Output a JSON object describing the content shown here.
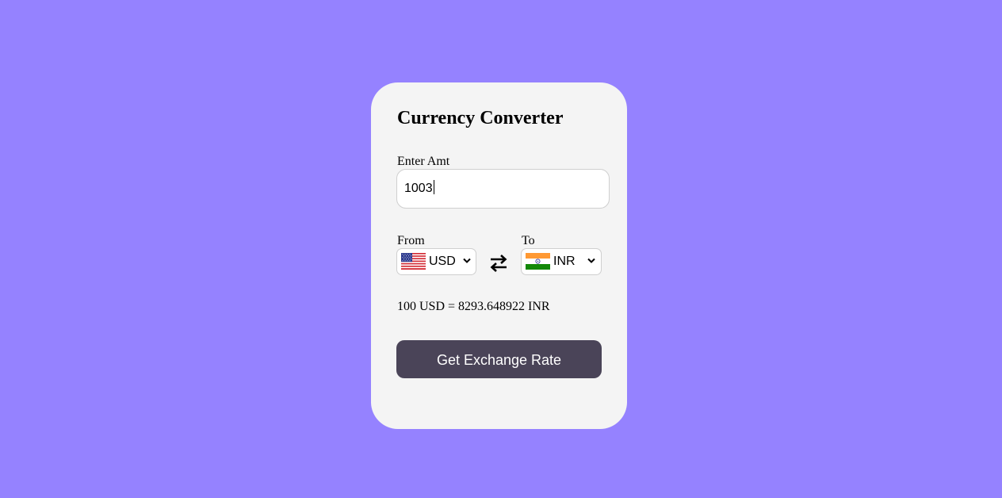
{
  "converter": {
    "title": "Currency Converter",
    "amount_label": "Enter Amt",
    "amount_value": "1003",
    "from_label": "From",
    "from_currency": "USD",
    "from_flag_icon": "us-flag-icon",
    "to_label": "To",
    "to_currency": "INR",
    "to_flag_icon": "india-flag-icon",
    "swap_icon": "swap-arrows-icon",
    "result_text": "100 USD = 8293.648922 INR",
    "button_label": "Get Exchange Rate"
  },
  "colors": {
    "background": "#9582ff",
    "card": "#f4f4f4",
    "button": "#4a4458",
    "button_text": "#ffffff"
  }
}
